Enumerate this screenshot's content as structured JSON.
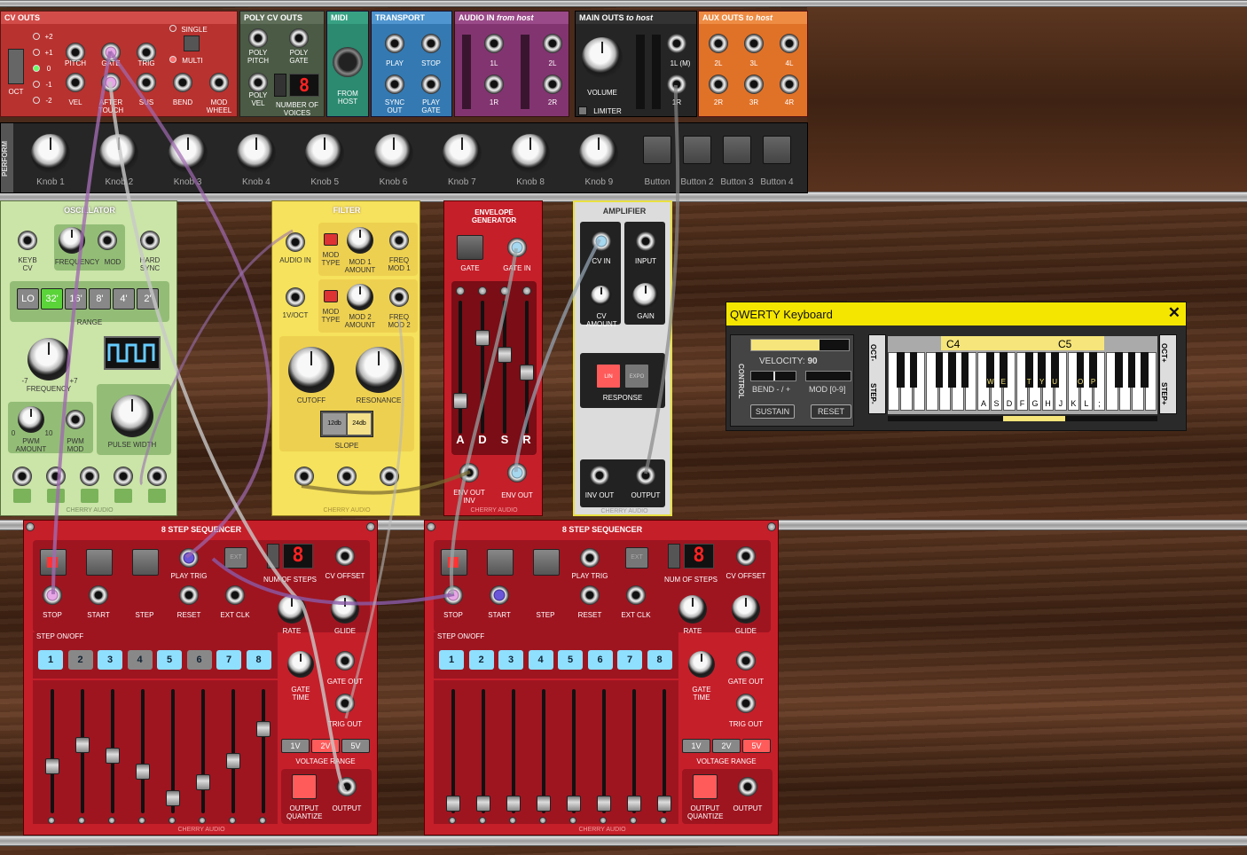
{
  "top_modules": {
    "cv_outs": {
      "title": "CV OUTS",
      "octave_values": [
        "+2",
        "+1",
        "0",
        "-1",
        "-2"
      ],
      "oct_label": "OCT",
      "jacks_row1": [
        "PITCH",
        "GATE",
        "TRIG"
      ],
      "single": "SINGLE",
      "multi": "MULTI",
      "jacks_row2": [
        "VEL",
        "AFTER TOUCH",
        "SUS",
        "BEND",
        "MOD WHEEL"
      ]
    },
    "poly_cv_outs": {
      "title": "POLY CV OUTS",
      "jacks": [
        "POLY PITCH",
        "POLY GATE",
        "POLY VEL"
      ],
      "voices_label": "NUMBER OF VOICES",
      "voices_value": "8"
    },
    "midi": {
      "title": "MIDI",
      "from_host": "FROM HOST"
    },
    "transport": {
      "title": "TRANSPORT",
      "jacks": [
        "PLAY",
        "STOP",
        "SYNC OUT",
        "PLAY GATE"
      ]
    },
    "audio_in": {
      "title": "AUDIO IN",
      "title_suffix": "from host",
      "jacks": [
        "1L",
        "2L",
        "1R",
        "2R"
      ]
    },
    "main_outs": {
      "title": "MAIN OUTS",
      "title_suffix": "to host",
      "volume": "VOLUME",
      "limiter": "LIMITER",
      "jacks": [
        "1L (M)",
        "1R"
      ]
    },
    "aux_outs": {
      "title": "AUX OUTS",
      "title_suffix": "to host",
      "jacks": [
        "2L",
        "3L",
        "4L",
        "2R",
        "3R",
        "4R"
      ]
    }
  },
  "perform": {
    "title": "PERFORM",
    "knobs": [
      "Knob 1",
      "Knob 2",
      "Knob 3",
      "Knob 4",
      "Knob 5",
      "Knob 6",
      "Knob 7",
      "Knob 8",
      "Knob 9"
    ],
    "buttons": [
      "Button",
      "Button 2",
      "Button 3",
      "Button 4"
    ]
  },
  "oscillator": {
    "title": "OSCILLATOR",
    "jacks_top": [
      "KEYB CV",
      "FREQUENCY",
      "MOD",
      "HARD SYNC"
    ],
    "range_label": "RANGE",
    "range_options": [
      "LO",
      "32'",
      "16'",
      "8'",
      "4'",
      "2'"
    ],
    "range_selected": "32'",
    "frequency": "FREQUENCY",
    "freq_min": "-7",
    "freq_max": "+7",
    "pwm_amount": "PWM AMOUNT",
    "pwm_mod": "PWM MOD",
    "pulse_width": "PULSE WIDTH",
    "pwm_min": "0",
    "pwm_max": "10",
    "brand": "CHERRY AUDIO"
  },
  "filter": {
    "title": "FILTER",
    "audio_in": "AUDIO IN",
    "voct": "1V/OCT",
    "mod_type": "MOD TYPE",
    "mod1_amount": "MOD 1 AMOUNT",
    "freq_mod1": "FREQ MOD 1",
    "mod2_amount": "MOD 2 AMOUNT",
    "freq_mod2": "FREQ MOD 2",
    "cutoff": "CUTOFF",
    "resonance": "RESONANCE",
    "slope": "SLOPE",
    "slope_options": [
      "12db",
      "24db"
    ],
    "brand": "CHERRY AUDIO"
  },
  "envelope": {
    "title": "ENVELOPE GENERATOR",
    "gate": "GATE",
    "gate_in": "GATE IN",
    "stages": [
      "A",
      "D",
      "S",
      "R"
    ],
    "stage_levels": [
      0.2,
      0.75,
      0.6,
      0.45
    ],
    "env_out_inv": "ENV OUT INV",
    "env_out": "ENV OUT",
    "brand": "CHERRY AUDIO"
  },
  "amplifier": {
    "title": "AMPLIFIER",
    "cv_in": "CV IN",
    "input": "INPUT",
    "cv_amount": "CV AMOUNT",
    "gain": "GAIN",
    "response": "RESPONSE",
    "response_options": [
      "LIN",
      "EXPO"
    ],
    "inv_out": "INV OUT",
    "output": "OUTPUT",
    "brand": "CHERRY AUDIO"
  },
  "sequencers": [
    {
      "title": "8 STEP SEQUENCER",
      "stop": "STOP",
      "start": "START",
      "step": "STEP",
      "play_trig": "PLAY TRIG",
      "reset": "RESET",
      "ext": "EXT",
      "ext_clk": "EXT CLK",
      "num_steps": "NUM OF STEPS",
      "num_value": "8",
      "cv_offset": "CV OFFSET",
      "rate": "RATE",
      "glide": "GLIDE",
      "step_onoff": "STEP ON/OFF",
      "steps": [
        "1",
        "2",
        "3",
        "4",
        "5",
        "6",
        "7",
        "8"
      ],
      "steps_on": [
        true,
        false,
        true,
        false,
        true,
        false,
        true,
        true
      ],
      "gate_time": "GATE TIME",
      "gate_out": "GATE OUT",
      "trig_out": "TRIG OUT",
      "voltage_range": "VOLTAGE RANGE",
      "ranges": [
        "1V",
        "2V",
        "5V"
      ],
      "range_selected": "2V",
      "output_quantize": "OUTPUT QUANTIZE",
      "output": "OUTPUT",
      "fader_levels": [
        0.35,
        0.55,
        0.45,
        0.3,
        0.05,
        0.2,
        0.4,
        0.7
      ],
      "brand": "CHERRY AUDIO"
    },
    {
      "title": "8 STEP SEQUENCER",
      "stop": "STOP",
      "start": "START",
      "step": "STEP",
      "play_trig": "PLAY TRIG",
      "reset": "RESET",
      "ext": "EXT",
      "ext_clk": "EXT CLK",
      "num_steps": "NUM OF STEPS",
      "num_value": "8",
      "cv_offset": "CV OFFSET",
      "rate": "RATE",
      "glide": "GLIDE",
      "step_onoff": "STEP ON/OFF",
      "steps": [
        "1",
        "2",
        "3",
        "4",
        "5",
        "6",
        "7",
        "8"
      ],
      "steps_on": [
        true,
        true,
        true,
        true,
        true,
        true,
        true,
        true
      ],
      "gate_time": "GATE TIME",
      "gate_out": "GATE OUT",
      "trig_out": "TRIG OUT",
      "voltage_range": "VOLTAGE RANGE",
      "ranges": [
        "1V",
        "2V",
        "5V"
      ],
      "range_selected": "5V",
      "output_quantize": "OUTPUT QUANTIZE",
      "output": "OUTPUT",
      "fader_levels": [
        0.0,
        0.0,
        0.0,
        0.0,
        0.0,
        0.0,
        0.0,
        0.0
      ],
      "brand": "CHERRY AUDIO"
    }
  ],
  "qwerty": {
    "title": "QWERTY Keyboard",
    "close": "✕",
    "control": "CONTROL",
    "velocity_label": "VELOCITY:",
    "velocity_value": "90",
    "bend_label": "BEND - / +",
    "mod_label": "MOD [0-9]",
    "sustain": "SUSTAIN",
    "reset": "RESET",
    "oct_minus": "OCT-",
    "oct_plus": "OCT+",
    "step_minus": "STEP-",
    "step_plus": "STEP+",
    "c4": "C4",
    "c5": "C5",
    "white_keys": [
      "A",
      "S",
      "D",
      "F",
      "G",
      "H",
      "J",
      "K",
      "L",
      ";"
    ],
    "black_keys": [
      "W",
      "E",
      "T",
      "Y",
      "U",
      "O",
      "P"
    ]
  },
  "colors": {
    "cv_outs": "#c8393a",
    "poly": "#4d5a46",
    "midi": "#2e8a72",
    "transport": "#3a7fb8",
    "audio_in": "#8a3a74",
    "main_outs": "#2a2a2a",
    "aux_outs": "#e0752a",
    "red_module": "#c51f2a",
    "yellow_module": "#f7e35a",
    "osc_module": "#c8e3a6",
    "amp_module": "#e0e0e0",
    "accent": "#ffee00"
  }
}
